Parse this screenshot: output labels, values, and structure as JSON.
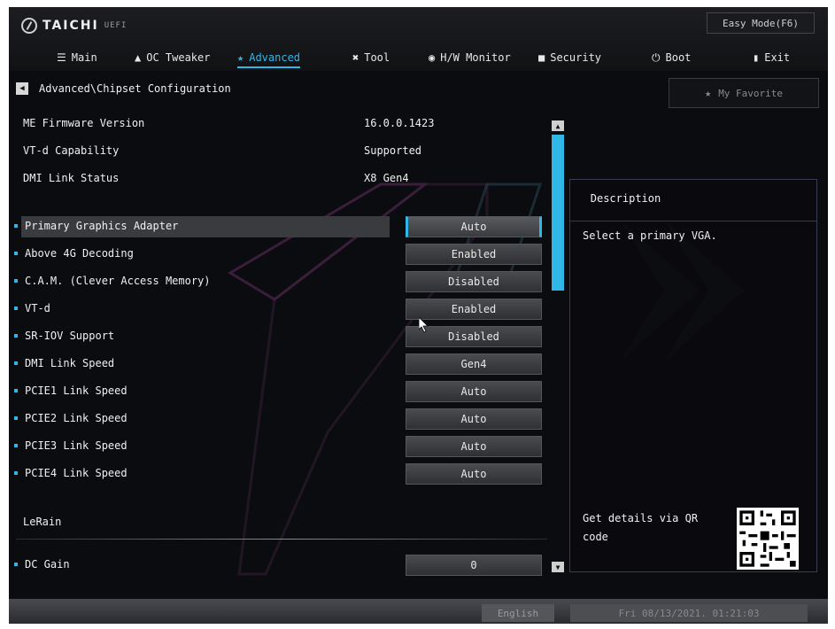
{
  "header": {
    "brand": "TAICHI",
    "brand_sub": "UEFI",
    "easy_mode_label": "Easy Mode(F6)"
  },
  "menu": [
    {
      "label": "Main",
      "icon": "list-icon"
    },
    {
      "label": "OC Tweaker",
      "icon": "rocket-icon"
    },
    {
      "label": "Advanced",
      "icon": "star-icon",
      "active": true
    },
    {
      "label": "Tool",
      "icon": "tools-icon"
    },
    {
      "label": "H/W Monitor",
      "icon": "monitor-icon"
    },
    {
      "label": "Security",
      "icon": "shield-icon"
    },
    {
      "label": "Boot",
      "icon": "power-icon"
    },
    {
      "label": "Exit",
      "icon": "door-icon"
    }
  ],
  "breadcrumb": "Advanced\\Chipset Configuration",
  "favorite_label": "My Favorite",
  "info": [
    {
      "label": "ME Firmware Version",
      "value": "16.0.0.1423"
    },
    {
      "label": "VT-d Capability",
      "value": "Supported"
    },
    {
      "label": "DMI Link Status",
      "value": "X8  Gen4"
    }
  ],
  "settings": [
    {
      "label": "Primary Graphics Adapter",
      "value": "Auto",
      "selected": true
    },
    {
      "label": "Above 4G Decoding",
      "value": "Enabled"
    },
    {
      "label": "C.A.M. (Clever Access Memory)",
      "value": "Disabled"
    },
    {
      "label": "VT-d",
      "value": "Enabled"
    },
    {
      "label": "SR-IOV Support",
      "value": "Disabled"
    },
    {
      "label": "DMI Link Speed",
      "value": "Gen4"
    },
    {
      "label": "PCIE1 Link Speed",
      "value": "Auto"
    },
    {
      "label": "PCIE2 Link Speed",
      "value": "Auto"
    },
    {
      "label": "PCIE3 Link Speed",
      "value": "Auto"
    },
    {
      "label": "PCIE4 Link Speed",
      "value": "Auto"
    }
  ],
  "section": {
    "label": "LeRain"
  },
  "dc_gain": {
    "label": "DC Gain",
    "value": "0"
  },
  "description": {
    "title": "Description",
    "text": "Select a primary VGA.",
    "qr_text": "Get details via QR code"
  },
  "footer": {
    "language": "English",
    "datetime": "Fri 08/13/2021. 01:21:03"
  },
  "colors": {
    "accent": "#2fb7e8",
    "background": "#0b0c0f"
  }
}
